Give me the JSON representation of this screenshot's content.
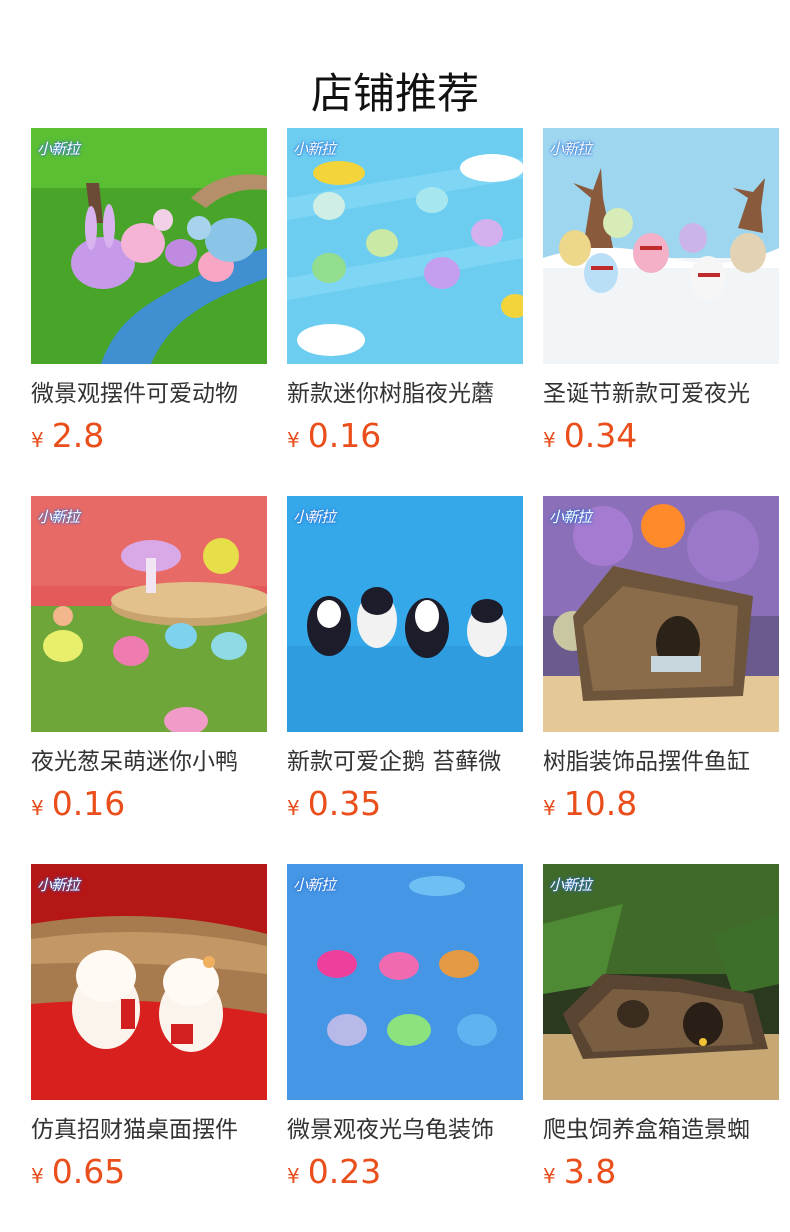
{
  "header": {
    "title": "店铺推荐"
  },
  "brand_logo_text": "小新拉",
  "currency_symbol": "¥",
  "colors": {
    "price": "#e94e1b",
    "title_text": "#333333",
    "heading_text": "#111111"
  },
  "products": [
    {
      "title": "微景观摆件可爱动物",
      "price": "2.8",
      "image": "glow-rabbits-on-grass"
    },
    {
      "title": "新款迷你树脂夜光蘑",
      "price": "0.16",
      "image": "glow-mushrooms-on-blue"
    },
    {
      "title": "圣诞节新款可爱夜光",
      "price": "0.34",
      "image": "glow-snowmen-in-snow"
    },
    {
      "title": "夜光葱呆萌迷你小鸭",
      "price": "0.16",
      "image": "glow-ducks-on-moss"
    },
    {
      "title": "新款可爱企鹅 苔藓微",
      "price": "0.35",
      "image": "penguins-on-blue"
    },
    {
      "title": "树脂装饰品摆件鱼缸",
      "price": "10.8",
      "image": "resin-log-aquarium"
    },
    {
      "title": "仿真招财猫桌面摆件",
      "price": "0.65",
      "image": "lucky-cats-on-red"
    },
    {
      "title": "微景观夜光乌龟装饰",
      "price": "0.23",
      "image": "glow-turtles-on-blue-sand"
    },
    {
      "title": "爬虫饲养盒箱造景蜘",
      "price": "3.8",
      "image": "reptile-hide-log"
    }
  ]
}
